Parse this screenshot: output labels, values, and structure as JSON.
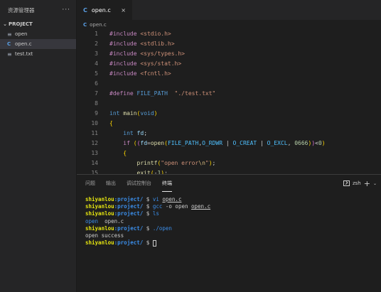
{
  "sidebar": {
    "title": "资源管理器",
    "more": "···",
    "project": "PROJECT",
    "files": [
      {
        "icon": "≡",
        "name": "open"
      },
      {
        "icon": "C",
        "name": "open.c"
      },
      {
        "icon": "≡",
        "name": "test.txt"
      }
    ]
  },
  "editor": {
    "tab": {
      "icon": "C",
      "label": "open.c",
      "close": "×"
    },
    "breadcrumb": {
      "icon": "C",
      "label": "open.c"
    }
  },
  "code": {
    "line_numbers": [
      "1",
      "2",
      "3",
      "4",
      "5",
      "6",
      "7",
      "8",
      "9",
      "10",
      "11",
      "12",
      "13",
      "14",
      "15"
    ],
    "lines": [
      "#include <stdio.h>",
      "#include <stdlib.h>",
      "#include <sys/types.h>",
      "#include <sys/stat.h>",
      "#include <fcntl.h>",
      "",
      "#define FILE_PATH  \"./test.txt\"",
      "",
      "int main(void)",
      "{",
      "    int fd;",
      "    if ((fd=open(FILE_PATH,O_RDWR | O_CREAT | O_EXCL, 0666))<0)",
      "    {",
      "        printf(\"open error\\n\");",
      "        exit(-1);"
    ]
  },
  "panel": {
    "tabs": [
      "问题",
      "输出",
      "调试控制台",
      "终端"
    ],
    "active_tab": "终端",
    "shell": "zsh",
    "plus": "+",
    "dropdown": "⌄"
  },
  "terminal": {
    "user": "shiyanlou",
    "path": ":project/",
    "dollar": "$",
    "cmd1_a": "vi",
    "cmd1_b": "open.c",
    "cmd2_a": "gcc",
    "cmd2_b": "-o open",
    "cmd2_c": "open.c",
    "cmd3": "ls",
    "ls_out_a": "open",
    "ls_out_b": "open.c",
    "cmd4": "./open",
    "out1": "open success"
  }
}
